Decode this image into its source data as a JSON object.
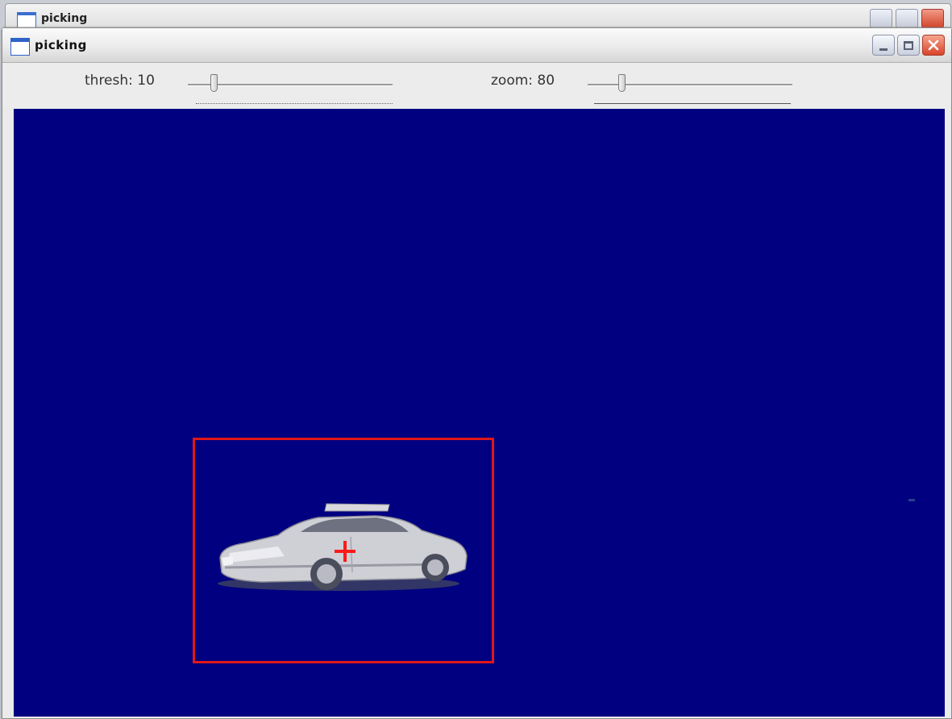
{
  "background_window": {
    "title": "picking"
  },
  "window": {
    "title": "picking",
    "buttons": {
      "minimize": "minimize",
      "maximize": "maximize",
      "close": "close"
    }
  },
  "toolbar": {
    "thresh": {
      "label": "thresh: 10",
      "value": 10
    },
    "zoom": {
      "label": "zoom: 80",
      "value": 80
    }
  },
  "canvas": {
    "background_color": "#000080",
    "selection_color": "#e01818",
    "object": "car"
  },
  "icons": {
    "app": "window-icon",
    "minimize": "minimize-icon",
    "maximize": "maximize-icon",
    "close": "close-icon",
    "crosshair": "crosshair-icon"
  }
}
